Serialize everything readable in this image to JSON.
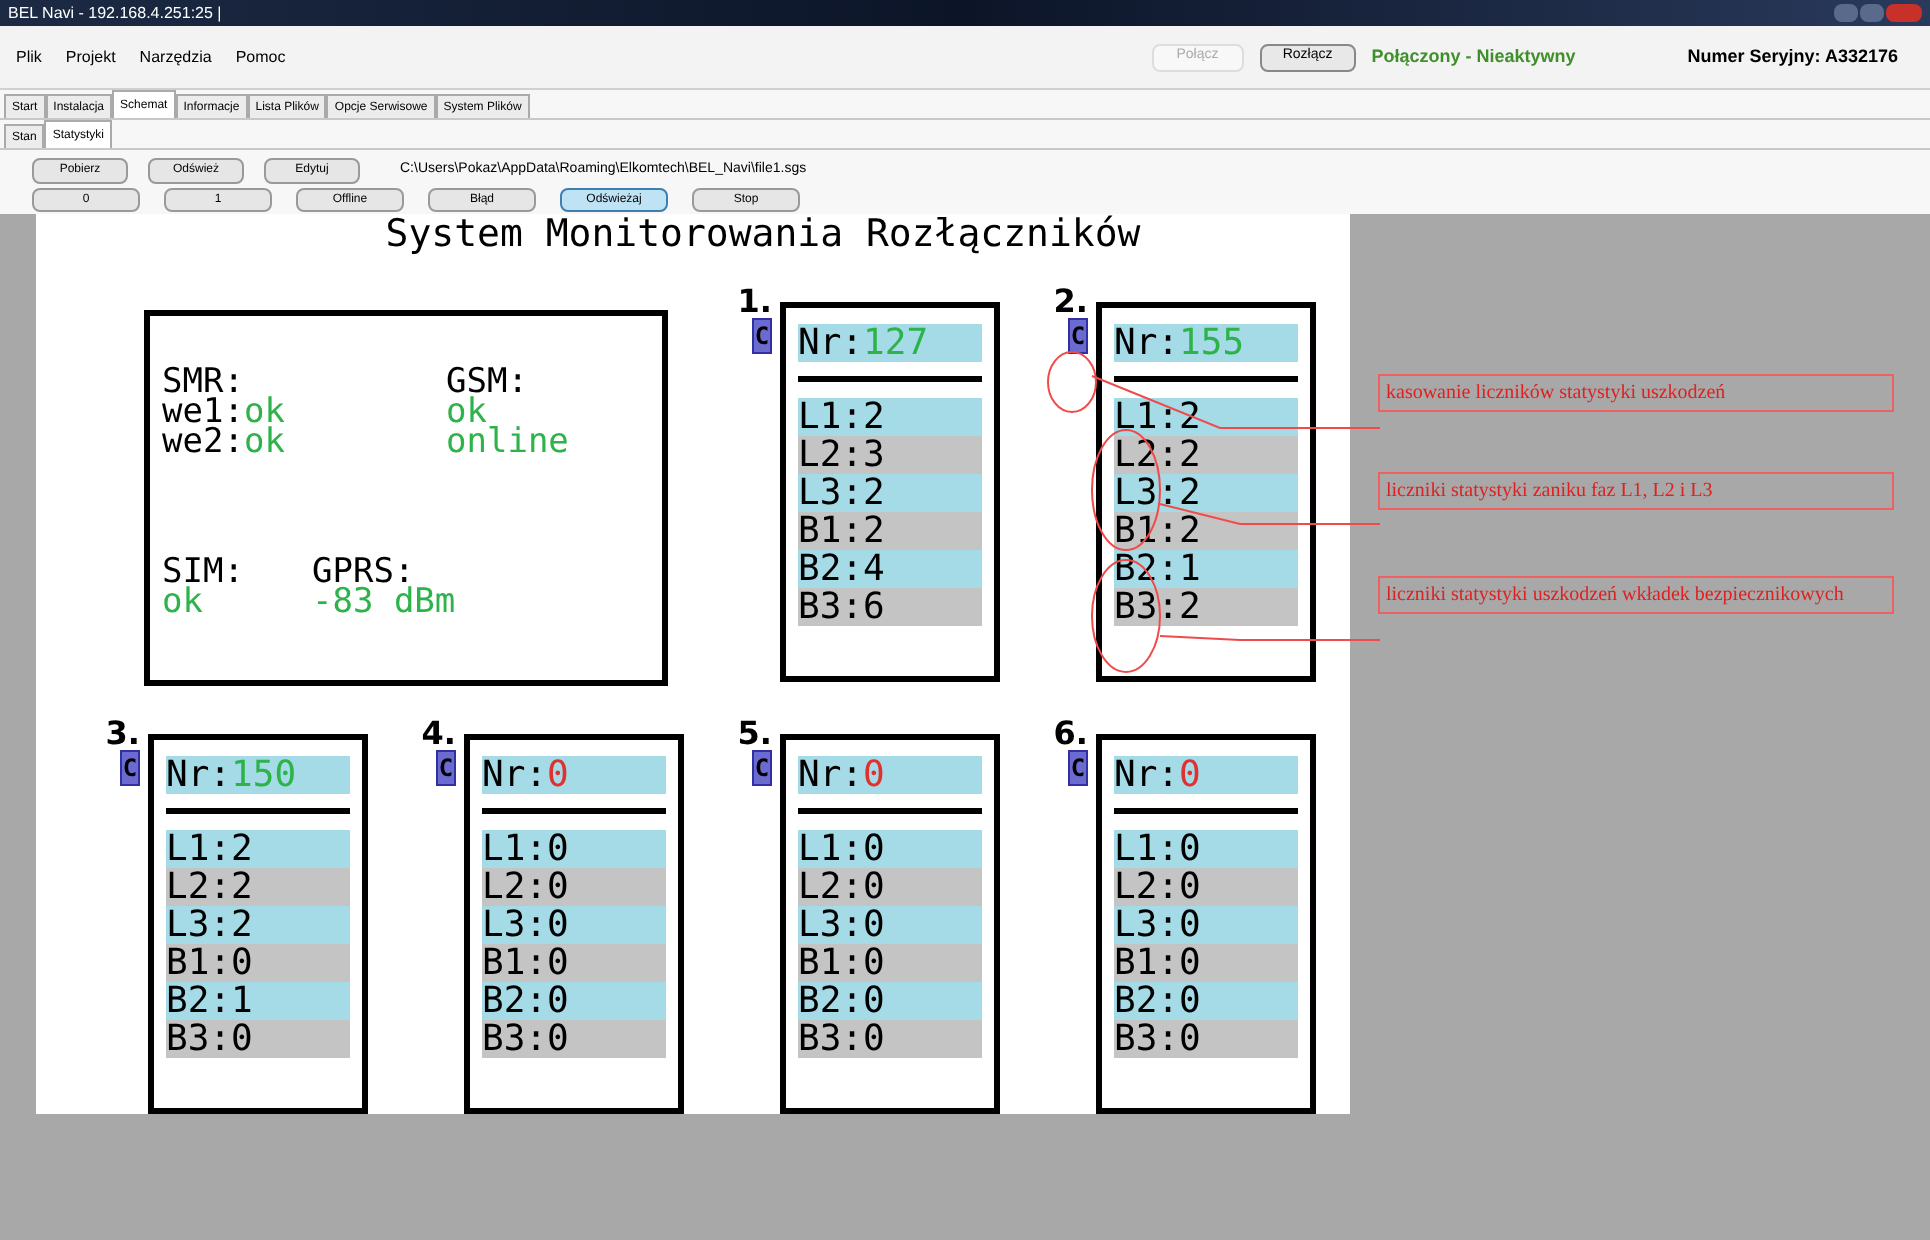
{
  "window": {
    "title": "BEL Navi - 192.168.4.251:25 |"
  },
  "menu": [
    "Plik",
    "Projekt",
    "Narzędzia",
    "Pomoc"
  ],
  "connection": {
    "connect_button": {
      "label": "Połącz",
      "disabled": true
    },
    "disconnect_button": {
      "label": "Rozłącz",
      "disabled": false
    },
    "status": "Połączony - Nieaktywny",
    "serial": "Numer Seryjny: A332176"
  },
  "tabs": [
    {
      "label": "Start",
      "selected": false
    },
    {
      "label": "Instalacja",
      "selected": false
    },
    {
      "label": "Schemat",
      "selected": true
    },
    {
      "label": "Informacje",
      "selected": false
    },
    {
      "label": "Lista Plików",
      "selected": false
    },
    {
      "label": "Opcje Serwisowe",
      "selected": false
    },
    {
      "label": "System Plików",
      "selected": false
    }
  ],
  "subtabs": [
    {
      "label": "Stan",
      "selected": false
    },
    {
      "label": "Statystyki",
      "selected": true
    }
  ],
  "toolbar": {
    "buttons": [
      "Pobierz",
      "Odśwież",
      "Edytuj"
    ],
    "path": "C:\\Users\\Pokaz\\AppData\\Roaming\\Elkomtech\\BEL_Navi\\file1.sgs"
  },
  "mode_buttons": [
    {
      "label": "0",
      "selected": false
    },
    {
      "label": "1",
      "selected": false
    },
    {
      "label": "Offline",
      "selected": false
    },
    {
      "label": "Błąd",
      "selected": false
    },
    {
      "label": "Odświeżaj",
      "selected": true
    },
    {
      "label": "Stop",
      "selected": false
    }
  ],
  "screen": {
    "title": "System Monitorowania Rozłączników",
    "status": {
      "smr_label": "SMR:",
      "we1_label": "we1:",
      "we1": "ok",
      "we2_label": "we2:",
      "we2": "ok",
      "gsm_label": "GSM:",
      "gsm_state": "ok",
      "gsm_mode": "online",
      "sim_label": "SIM:",
      "sim": "ok",
      "gprs_label": "GPRS:",
      "gprs": "-83 dBm"
    },
    "cards": [
      {
        "number": "1.",
        "reset": "C",
        "nr_label": "Nr:",
        "nr": "127",
        "alarm": false,
        "counters": [
          "L1:2",
          "L2:3",
          "L3:2",
          "B1:2",
          "B2:4",
          "B3:6"
        ]
      },
      {
        "number": "2.",
        "reset": "C",
        "nr_label": "Nr:",
        "nr": "155",
        "alarm": false,
        "counters": [
          "L1:2",
          "L2:2",
          "L3:2",
          "B1:2",
          "B2:1",
          "B3:2"
        ]
      },
      {
        "number": "3.",
        "reset": "C",
        "nr_label": "Nr:",
        "nr": "150",
        "alarm": false,
        "counters": [
          "L1:2",
          "L2:2",
          "L3:2",
          "B1:0",
          "B2:1",
          "B3:0"
        ]
      },
      {
        "number": "4.",
        "reset": "C",
        "nr_label": "Nr:",
        "nr": "0",
        "alarm": true,
        "counters": [
          "L1:0",
          "L2:0",
          "L3:0",
          "B1:0",
          "B2:0",
          "B3:0"
        ]
      },
      {
        "number": "5.",
        "reset": "C",
        "nr_label": "Nr:",
        "nr": "0",
        "alarm": true,
        "counters": [
          "L1:0",
          "L2:0",
          "L3:0",
          "B1:0",
          "B2:0",
          "B3:0"
        ]
      },
      {
        "number": "6.",
        "reset": "C",
        "nr_label": "Nr:",
        "nr": "0",
        "alarm": true,
        "counters": [
          "L1:0",
          "L2:0",
          "L3:0",
          "B1:0",
          "B2:0",
          "B3:0"
        ]
      }
    ]
  },
  "annotations": [
    "kasowanie liczników statystyki uszkodzeń",
    "liczniki statystyki zaniku faz L1, L2 i L3",
    "liczniki statystyki uszkodzeń wkładek bezpiecznikowych"
  ]
}
